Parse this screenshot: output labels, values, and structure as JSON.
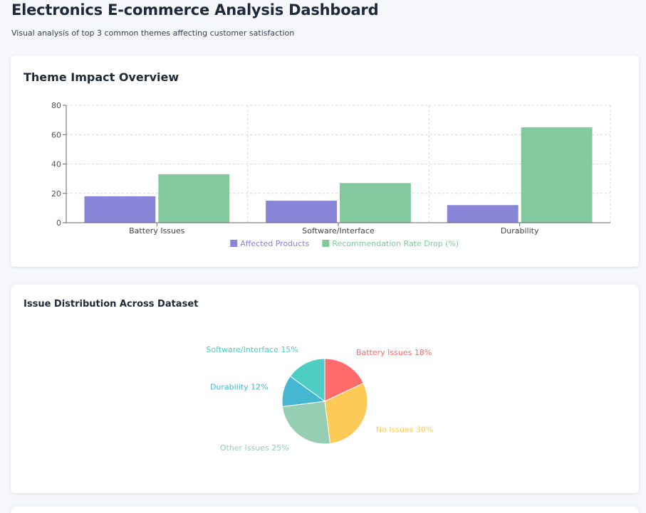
{
  "header": {
    "title": "Electronics E-commerce Analysis Dashboard",
    "subtitle": "Visual analysis of top 3 common themes affecting customer satisfaction"
  },
  "bar_card": {
    "title": "Theme Impact Overview"
  },
  "pie_card": {
    "title": "Issue Distribution Across Dataset"
  },
  "chart_data": [
    {
      "type": "bar",
      "title": "Theme Impact Overview",
      "categories": [
        "Battery Issues",
        "Software/Interface",
        "Durability"
      ],
      "series": [
        {
          "name": "Affected Products",
          "values": [
            18,
            15,
            12
          ],
          "color": "#8884d8"
        },
        {
          "name": "Recommendation Rate Drop (%)",
          "values": [
            33,
            27,
            65
          ],
          "color": "#82ca9d"
        }
      ],
      "yticks": [
        0,
        20,
        40,
        60,
        80
      ],
      "ylim": [
        0,
        80
      ],
      "grid": true,
      "legend": "bottom"
    },
    {
      "type": "pie",
      "title": "Issue Distribution Across Dataset",
      "slices": [
        {
          "label": "Battery Issues 18%",
          "value": 18,
          "color": "#ff6b6b"
        },
        {
          "label": "No Issues 30%",
          "value": 30,
          "color": "#feca57"
        },
        {
          "label": "Other Issues 25%",
          "value": 25,
          "color": "#96ceb4"
        },
        {
          "label": "Durability 12%",
          "value": 12,
          "color": "#45b7d1"
        },
        {
          "label": "Software/Interface 15%",
          "value": 15,
          "color": "#4ecdc4"
        }
      ]
    }
  ]
}
